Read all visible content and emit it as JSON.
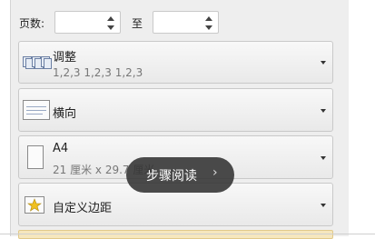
{
  "page_range": {
    "label": "页数:",
    "from_value": "",
    "to_label": "至",
    "to_value": ""
  },
  "collation": {
    "label": "调整",
    "detail": "1,2,3    1,2,3    1,2,3",
    "icon": "collate-pages-icon"
  },
  "orientation": {
    "label": "横向",
    "icon": "landscape-page-icon"
  },
  "paper_size": {
    "label": "A4",
    "detail": "21 厘米 x 29.7 厘米",
    "icon": "paper-page-icon"
  },
  "margins": {
    "label": "自定义边距",
    "icon": "custom-margins-star-icon"
  },
  "tooltip": {
    "text": "步骤阅读",
    "chevron": "›"
  }
}
